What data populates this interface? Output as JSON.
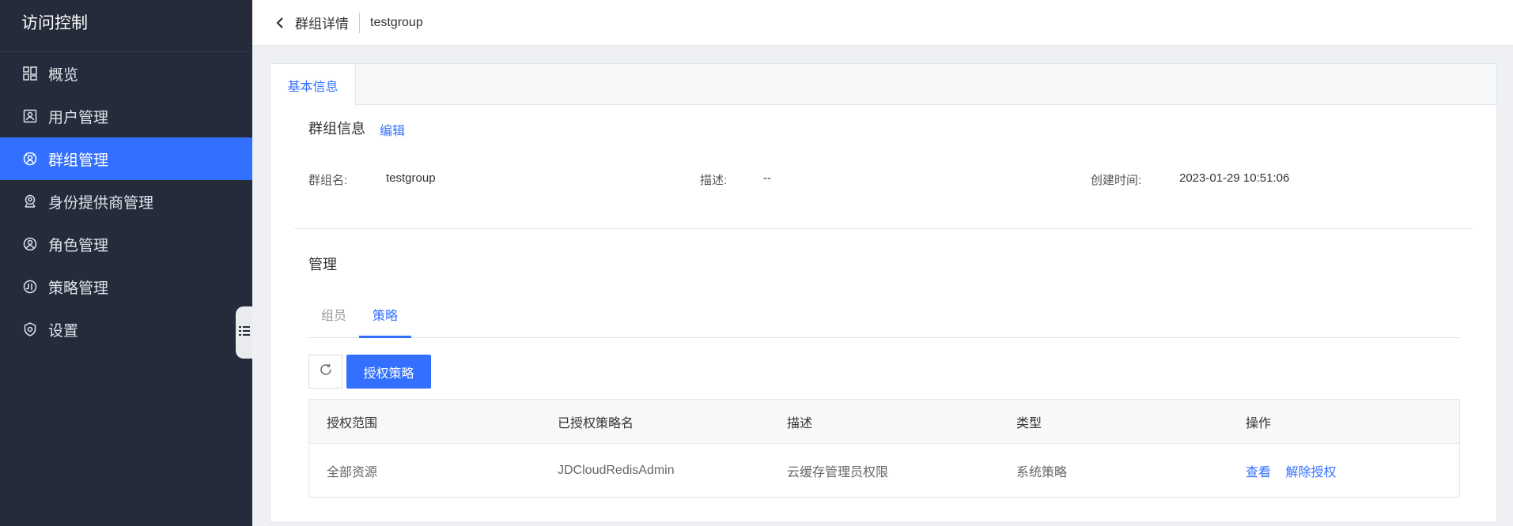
{
  "sidebar": {
    "title": "访问控制",
    "items": [
      {
        "label": "概览",
        "icon": "dashboard-icon"
      },
      {
        "label": "用户管理",
        "icon": "user-card-icon"
      },
      {
        "label": "群组管理",
        "icon": "group-icon",
        "active": true
      },
      {
        "label": "身份提供商管理",
        "icon": "identity-provider-icon"
      },
      {
        "label": "角色管理",
        "icon": "role-icon"
      },
      {
        "label": "策略管理",
        "icon": "policy-icon"
      },
      {
        "label": "设置",
        "icon": "settings-shield-icon"
      }
    ]
  },
  "header": {
    "title": "群组详情",
    "subtitle": "testgroup"
  },
  "tabs": {
    "basic_info": "基本信息"
  },
  "group_info": {
    "title": "群组信息",
    "edit": "编辑",
    "name_label": "群组名:",
    "name_value": "testgroup",
    "desc_label": "描述:",
    "desc_value": "--",
    "created_label": "创建时间:",
    "created_value": "2023-01-29 10:51:06"
  },
  "manage": {
    "title": "管理",
    "tabs": [
      "组员",
      "策略"
    ],
    "active_tab": "策略",
    "authorize_button": "授权策略"
  },
  "table": {
    "columns": [
      "授权范围",
      "已授权策略名",
      "描述",
      "类型",
      "操作"
    ],
    "rows": [
      {
        "scope": "全部资源",
        "policy_name": "JDCloudRedisAdmin",
        "description": "云缓存管理员权限",
        "type": "系统策略",
        "actions": [
          "查看",
          "解除授权"
        ]
      }
    ]
  },
  "colors": {
    "sidebar_bg": "#252b3b",
    "accent": "#3370ff"
  }
}
